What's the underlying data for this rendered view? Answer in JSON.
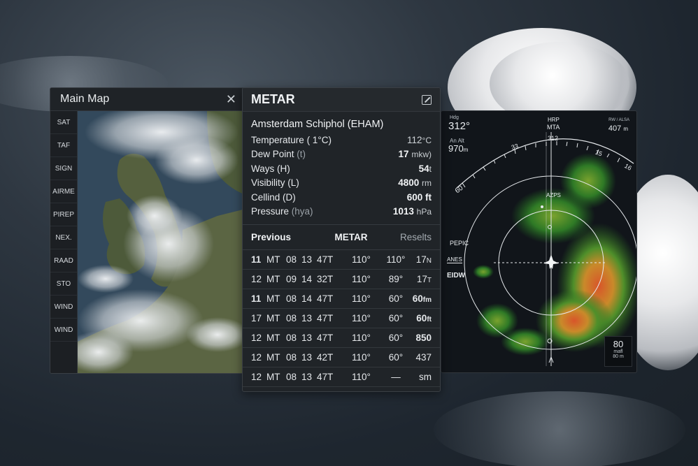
{
  "map_panel": {
    "title": "Main Map",
    "layers": [
      "SAT",
      "TAF",
      "SIGN",
      "AIRME",
      "PIREP",
      "NEX.",
      "RAAD",
      "STO",
      "WIND",
      "WIND"
    ]
  },
  "metar": {
    "title": "METAR",
    "station": "Amsterdam Schiphol (EHAM)",
    "fields": {
      "temperature": {
        "label": "Temperature",
        "paren": "( 1°C)",
        "value": "112",
        "unit": "°C"
      },
      "dew_point": {
        "label": "Dew Point",
        "paren": "(t)",
        "value": "17",
        "unit": "mkw)"
      },
      "ways": {
        "label": "Ways",
        "paren": "(H)",
        "value": "54",
        "unit": "t"
      },
      "visibility": {
        "label": "Visibility",
        "paren": "(L)",
        "value": "4800",
        "unit": "rm"
      },
      "cellind": {
        "label": "Cellind",
        "paren": "(D)",
        "value": "600 ft",
        "unit": ""
      },
      "pressure": {
        "label": "Pressure",
        "paren": "(hya)",
        "value": "1013",
        "unit": "hPa"
      }
    },
    "table": {
      "headers": {
        "previous": "Previous",
        "metar": "METAR",
        "results": "Reselts"
      },
      "rows": [
        {
          "a": "11",
          "b": "MT",
          "c": "08",
          "d": "13",
          "e": "47T",
          "f": "110°",
          "g": "110°",
          "h": "17",
          "h_unit": "N"
        },
        {
          "a": "12",
          "b": "MT",
          "c": "09",
          "d": "14",
          "e": "32T",
          "f": "110°",
          "g": "89°",
          "h": "17",
          "h_unit": "T"
        },
        {
          "a": "11",
          "b": "MT",
          "c": "08",
          "d": "14",
          "e": "47T",
          "f": "110°",
          "g": "60°",
          "h": "60",
          "h_unit": "fm"
        },
        {
          "a": "17",
          "b": "MT",
          "c": "08",
          "d": "13",
          "e": "47T",
          "f": "110°",
          "g": "60°",
          "h": "60",
          "h_unit": "ft"
        },
        {
          "a": "12",
          "b": "MT",
          "c": "08",
          "d": "13",
          "e": "47T",
          "f": "110°",
          "g": "60°",
          "h": "850",
          "h_unit": ""
        },
        {
          "a": "12",
          "b": "MT",
          "c": "08",
          "d": "13",
          "e": "42T",
          "f": "110°",
          "g": "60°",
          "h": "437",
          "h_unit": ""
        },
        {
          "a": "12",
          "b": "MT",
          "c": "08",
          "d": "13",
          "e": "47T",
          "f": "110°",
          "g": "—",
          "h": "sm",
          "h_unit": ""
        }
      ]
    }
  },
  "radar": {
    "heading_readout": "312°",
    "heading_small": "Hdg",
    "alt_small": "An Alt",
    "alt_value": "970",
    "alt_unit": "m",
    "top_center_small": "HRP",
    "top_center_label": "MTA",
    "top_scale_label": "312",
    "top_right_small": "RW / ALSA",
    "top_right_value": "407",
    "top_right_unit": "m",
    "scale_left_1": "60",
    "scale_33": "33",
    "scale_15": "15",
    "scale_16": "16",
    "ring_label": "AZPS",
    "pepic": "PEPIC",
    "anes": "ANES",
    "eidw": "EIDW",
    "box_value": "80",
    "box_unit": "mafl",
    "box_sub": "80 m"
  }
}
